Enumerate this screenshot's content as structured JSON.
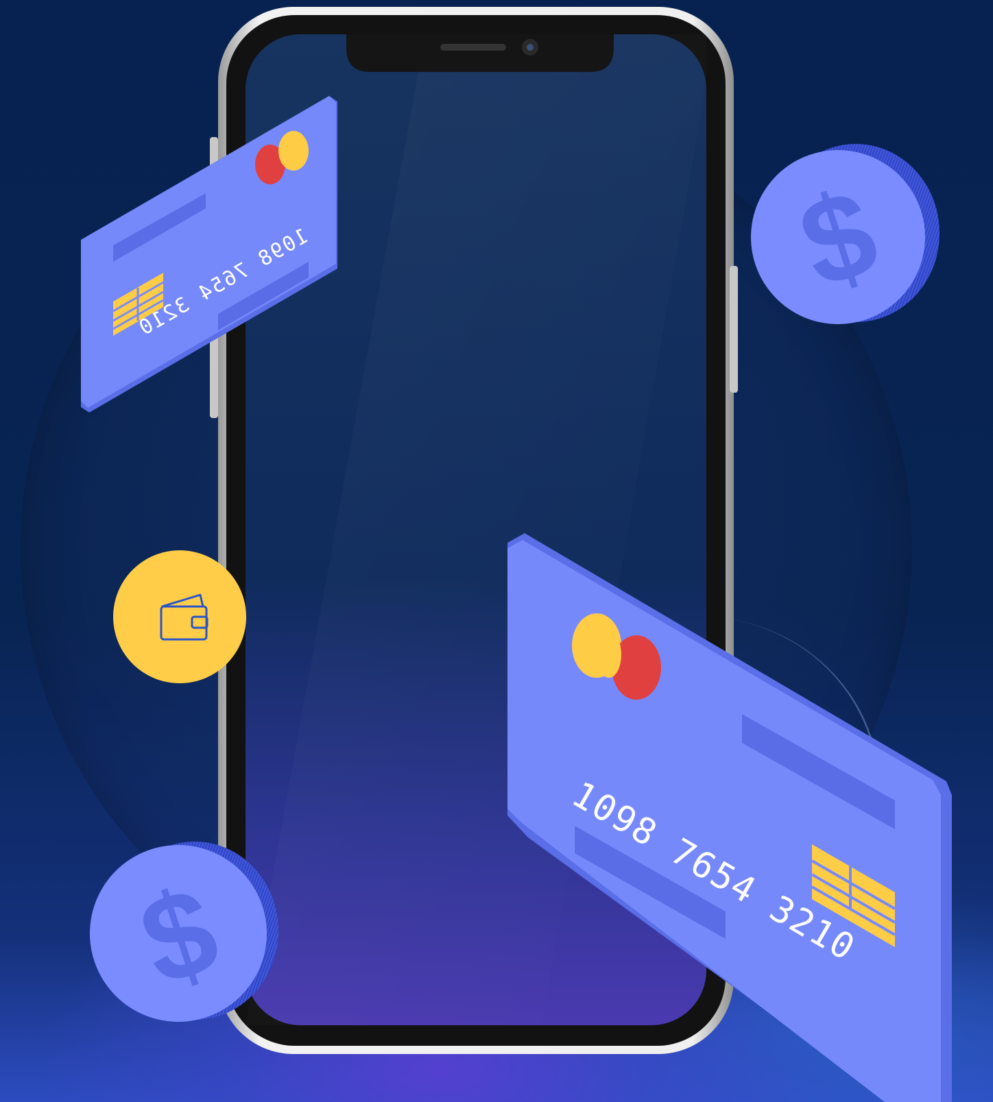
{
  "top_card": {
    "number": "1098 7654 3210",
    "colors": {
      "face": "#7689fb",
      "edge": "#5a6ee8",
      "stripe": "#5a6de6",
      "chip": "#ffcc45",
      "logo_left": "#e0403f",
      "logo_right": "#ffcc45"
    }
  },
  "bottom_card": {
    "number": "1098 7654 3210",
    "colors": {
      "face": "#7689fb",
      "edge": "#5a6ee8",
      "stripe": "#5a6de6",
      "chip": "#ffcc45",
      "logo_left": "#ffcc45",
      "logo_right": "#e0403f"
    }
  },
  "coins": [
    {
      "symbol": "$",
      "face": "#7a8cff",
      "rim": "#4a5fe0"
    },
    {
      "symbol": "$",
      "face": "#7a8cff",
      "rim": "#4a5fe0"
    }
  ],
  "wallet_badge": {
    "icon": "wallet-icon",
    "color": "#ffcd47",
    "stroke": "#2a55c8"
  },
  "phone": {
    "frame": "#d9d9d9",
    "bezel": "#111111",
    "screen": "#0b2a5a"
  },
  "background": {
    "top": "#072250",
    "bottom": "#3a4cd0"
  }
}
